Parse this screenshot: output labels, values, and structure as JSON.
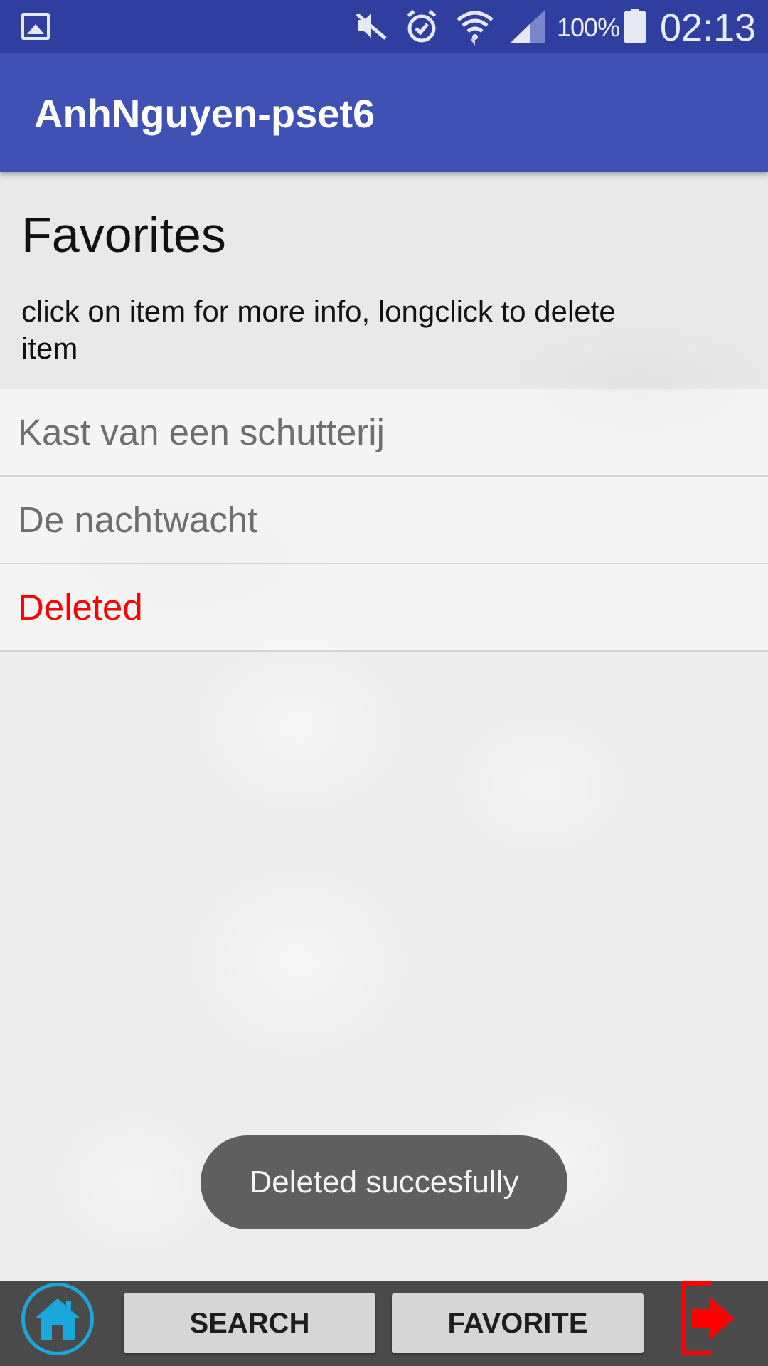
{
  "status_bar": {
    "battery_text": "100%",
    "time": "02:13",
    "battery_level": 1.0,
    "icons": [
      "image-notification-icon",
      "mute-icon",
      "alarm-icon",
      "wifi-icon",
      "signal-icon",
      "battery-icon"
    ]
  },
  "app_bar": {
    "title": "AnhNguyen-pset6",
    "color": "#3f51b5"
  },
  "page": {
    "title": "Favorites",
    "instructions": "click on item for more info, longclick to delete item"
  },
  "favorites": {
    "items": [
      {
        "label": "Kast van een schutterij",
        "status": "normal"
      },
      {
        "label": "De nachtwacht",
        "status": "normal"
      },
      {
        "label": "Deleted",
        "status": "deleted"
      }
    ]
  },
  "toast": {
    "message": "Deleted succesfully"
  },
  "bottom_nav": {
    "home_icon": "home-icon",
    "search_label": "SEARCH",
    "favorite_label": "FAVORITE",
    "logout_icon": "logout-icon",
    "accent_color": "#19a7dc",
    "logout_color": "#ff0000"
  }
}
